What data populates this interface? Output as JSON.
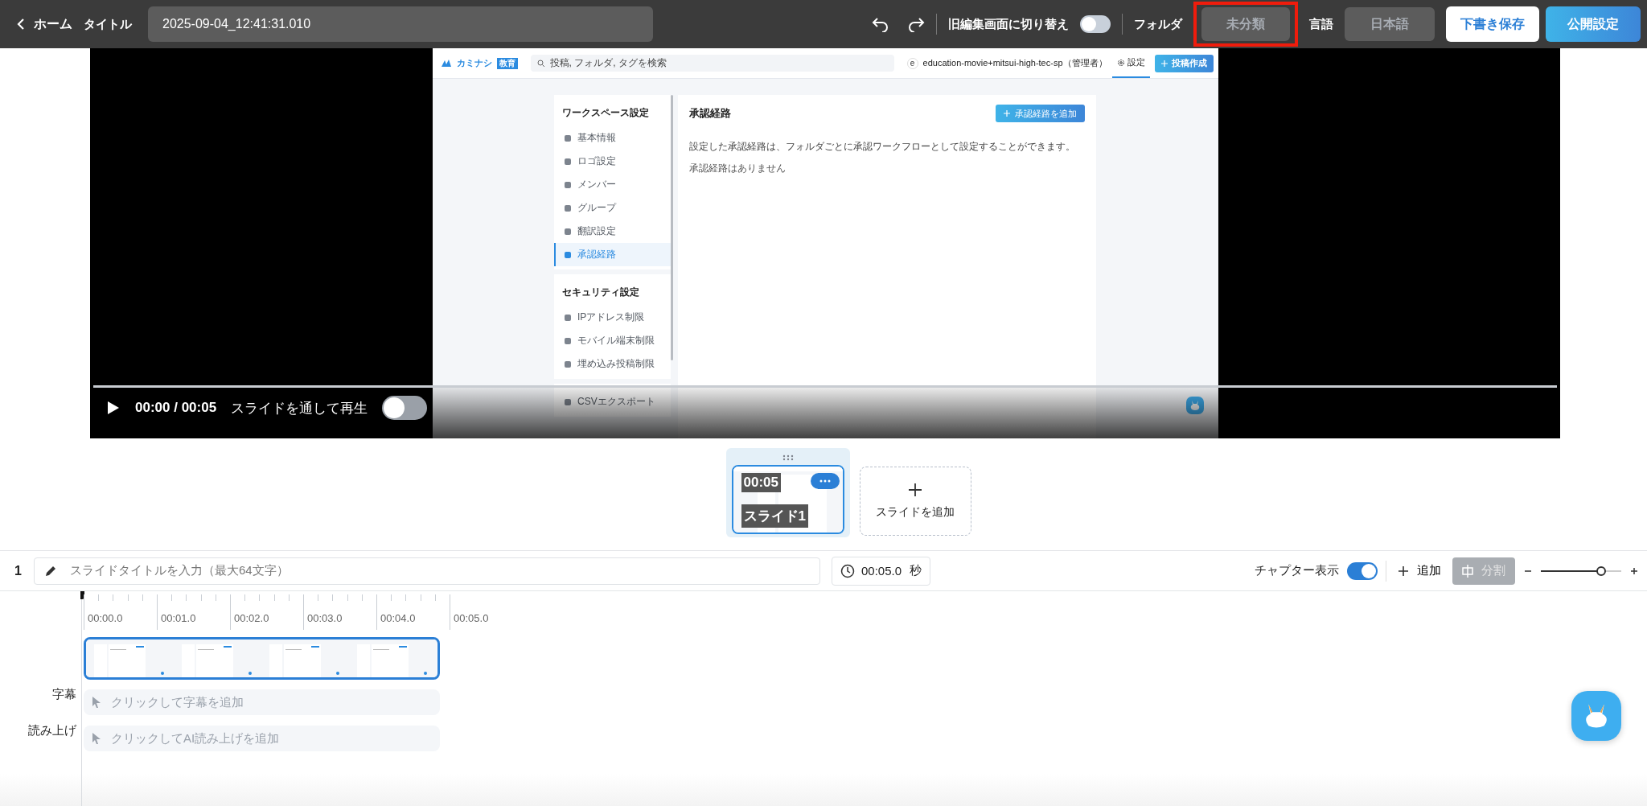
{
  "topbar": {
    "back": "ホーム",
    "title_label": "タイトル",
    "title_value": "2025-09-04_12:41:31.010",
    "legacy_toggle": {
      "label": "旧編集画面に切り替え",
      "on": false
    },
    "folder": {
      "label": "フォルダ",
      "value": "未分類",
      "highlighted": true
    },
    "language": {
      "label": "言語",
      "value": "日本語"
    },
    "buttons": [
      {
        "label": "下書き保存",
        "kind": "secondary"
      },
      {
        "label": "公開設定",
        "kind": "primary"
      }
    ]
  },
  "video": {
    "screen": {
      "logo": "カミナシ",
      "logo_badge": "教育",
      "search_placeholder": "投稿, フォルダ, タグを検索",
      "account_initial": "e",
      "account": "education-movie+mitsui-high-tec-sp（管理者）",
      "settings": "設定",
      "create_button": "投稿作成",
      "sidebar": [
        {
          "heading": "ワークスペース設定",
          "items": [
            {
              "label": "基本情報",
              "selected": false
            },
            {
              "label": "ロゴ設定",
              "selected": false
            },
            {
              "label": "メンバー",
              "selected": false
            },
            {
              "label": "グループ",
              "selected": false
            },
            {
              "label": "翻訳設定",
              "selected": false
            },
            {
              "label": "承認経路",
              "selected": true
            }
          ]
        },
        {
          "heading": "セキュリティ設定",
          "items": [
            {
              "label": "IPアドレス制限",
              "selected": false
            },
            {
              "label": "モバイル端末制限",
              "selected": false
            },
            {
              "label": "埋め込み投稿制限",
              "selected": false
            }
          ]
        },
        {
          "items": [
            {
              "label": "CSVエクスポート",
              "selected": false
            }
          ]
        }
      ],
      "page_title": "承認経路",
      "add_button": "承認経路を追加",
      "description": "設定した承認経路は、フォルダごとに承認ワークフローとして設定することができます。",
      "empty": "承認経路はありません"
    },
    "level": 0,
    "time": "00:00 / 00:05",
    "play_through": {
      "label": "スライドを通して再生",
      "on": false
    }
  },
  "slides": [
    {
      "time": "00:05",
      "label": "スライド1",
      "selected": true
    }
  ],
  "add_slide": "スライドを追加",
  "toolbar": {
    "index": "1",
    "title_placeholder": "スライドタイトルを入力（最大64文字）",
    "duration": "00:05.0",
    "unit": "秒",
    "chapter": {
      "label": "チャプター表示",
      "on": true
    },
    "add": "追加",
    "split": {
      "label": "分割",
      "disabled": true
    },
    "zoom": {
      "level": 0.75
    }
  },
  "timeline": {
    "ticks": [
      "00:00.0",
      "00:01.0",
      "00:02.0",
      "00:03.0",
      "00:04.0",
      "00:05.0"
    ],
    "tracks": [
      {
        "label": "字幕",
        "placeholder": "クリックして字幕を追加"
      },
      {
        "label": "読み上げ",
        "placeholder": "クリックしてAI読み上げを追加"
      }
    ]
  }
}
